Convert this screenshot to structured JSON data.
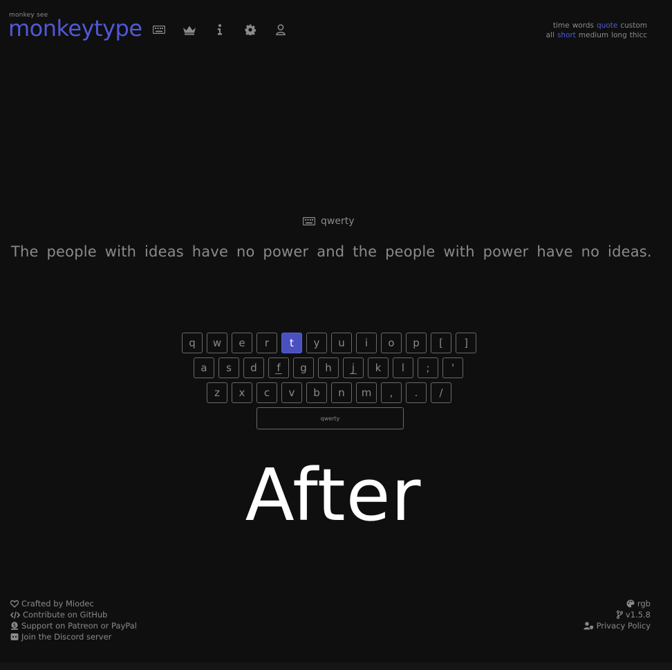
{
  "header": {
    "tagline": "monkey see",
    "logo": "monkeytype",
    "nav": [
      {
        "name": "keyboard-icon"
      },
      {
        "name": "crown-icon"
      },
      {
        "name": "info-icon"
      },
      {
        "name": "gear-icon"
      },
      {
        "name": "user-icon"
      }
    ]
  },
  "modes": {
    "row1": [
      "time",
      "words",
      "quote",
      "custom"
    ],
    "row1_active": "quote",
    "row2": [
      "all",
      "short",
      "medium",
      "long",
      "thicc"
    ],
    "row2_active": "short"
  },
  "layout_indicator": {
    "icon": "keyboard-icon",
    "label": "qwerty"
  },
  "quote_text": "The people with ideas have no power and the people with power have no ideas.",
  "keymap": {
    "row1": [
      "q",
      "w",
      "e",
      "r",
      "t",
      "y",
      "u",
      "i",
      "o",
      "p",
      "[",
      "]"
    ],
    "row2": [
      "a",
      "s",
      "d",
      "f",
      "g",
      "h",
      "j",
      "k",
      "l",
      ";",
      "'"
    ],
    "row3": [
      "z",
      "x",
      "c",
      "v",
      "b",
      "n",
      "m",
      ",",
      ".",
      "/"
    ],
    "active_key": "t",
    "home_bumps": [
      "f",
      "j"
    ],
    "spacebar_label": "qwerty"
  },
  "overlay": "After",
  "footer": {
    "left": [
      {
        "icon": "heart-icon",
        "text": "Crafted by Miodec"
      },
      {
        "icon": "code-icon",
        "text": "Contribute on GitHub"
      },
      {
        "icon": "donate-icon",
        "text": "Support on Patreon or PayPal"
      },
      {
        "icon": "discord-icon",
        "text": "Join the Discord server"
      }
    ],
    "right": [
      {
        "icon": "palette-icon",
        "text": "rgb"
      },
      {
        "icon": "branch-icon",
        "text": "v1.5.8"
      },
      {
        "icon": "user-shield-icon",
        "text": "Privacy Policy"
      }
    ]
  },
  "colors": {
    "background": "#0f0f10",
    "main": "#5059d6",
    "sub": "#8a8a8a",
    "text": "#ffffff"
  }
}
